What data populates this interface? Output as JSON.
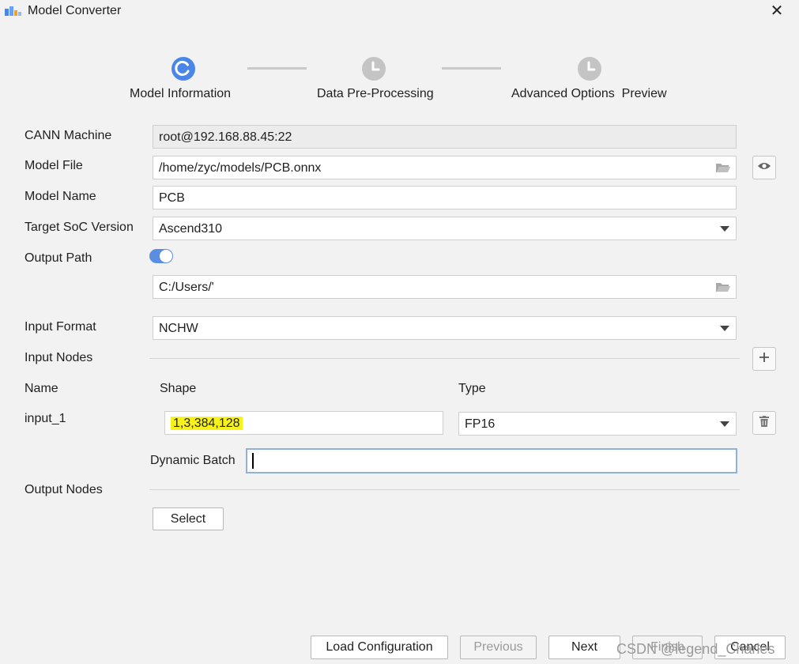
{
  "window": {
    "title": "Model Converter",
    "close_label": "✕"
  },
  "steps": [
    {
      "label": "Model Information",
      "state": "active"
    },
    {
      "label": "Data Pre-Processing",
      "state": "pending"
    },
    {
      "label": "Advanced Options  Preview",
      "state": "pending"
    }
  ],
  "form": {
    "cann_machine": {
      "label": "CANN Machine",
      "value": "root@192.168.88.45:22"
    },
    "model_file": {
      "label": "Model File",
      "value": "/home/zyc/models/PCB.onnx"
    },
    "model_name": {
      "label": "Model Name",
      "value": "PCB"
    },
    "target_soc": {
      "label": "Target SoC Version",
      "value": "Ascend310"
    },
    "output_path": {
      "label": "Output Path",
      "toggle_on": true,
      "value": "C:/Users/'"
    },
    "input_format": {
      "label": "Input Format",
      "value": "NCHW"
    },
    "input_nodes": {
      "label": "Input Nodes",
      "col_name": "Name",
      "col_shape": "Shape",
      "col_type": "Type",
      "rows": [
        {
          "name": "input_1",
          "shape": "1,3,384,128",
          "type": "FP16"
        }
      ],
      "dynamic_batch_label": "Dynamic Batch",
      "dynamic_batch_value": ""
    },
    "output_nodes": {
      "label": "Output Nodes",
      "select_button": "Select"
    }
  },
  "footer": {
    "load_config": "Load Configuration",
    "previous": "Previous",
    "next": "Next",
    "finish": "Finish",
    "cancel": "Cancel"
  },
  "watermark": "CSDN @legend_Charles",
  "colors": {
    "accent": "#4a86e8",
    "highlight": "#f7f21a",
    "pending_step": "#c4c4c4"
  }
}
